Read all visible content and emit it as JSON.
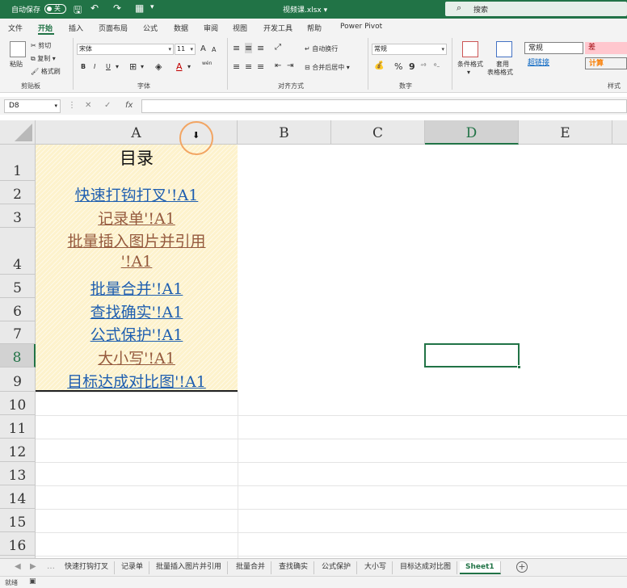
{
  "titlebar": {
    "autosave_label": "自动保存",
    "autosave_state": "关",
    "filename": "视频课.xlsx",
    "search_placeholder": "搜索"
  },
  "ribbon_tabs": [
    "文件",
    "开始",
    "插入",
    "页面布局",
    "公式",
    "数据",
    "审阅",
    "视图",
    "开发工具",
    "帮助",
    "Power Pivot"
  ],
  "ribbon": {
    "clipboard": {
      "paste": "粘贴",
      "cut": "剪切",
      "copy": "复制",
      "format_painter": "格式刷",
      "group": "剪贴板"
    },
    "font": {
      "name": "宋体",
      "size": "11",
      "bold": "B",
      "italic": "I",
      "underline": "U",
      "grow": "A",
      "shrink": "A",
      "color_glyph": "A",
      "phonetic": "wén",
      "group": "字体"
    },
    "alignment": {
      "wrap_text": "自动换行",
      "merge_center": "合并后居中",
      "group": "对齐方式"
    },
    "number": {
      "format": "常规",
      "percent": "%",
      "comma": "9",
      "group": "数字"
    },
    "styles": {
      "conditional": "条件格式",
      "table_format_1": "套用",
      "table_format_2": "表格格式",
      "normal": "常规",
      "bad": "差",
      "hyperlink": "超链接",
      "calc": "计算",
      "group": "样式"
    }
  },
  "formula_bar": {
    "name_box": "D8",
    "cancel": "✕",
    "enter": "✓",
    "fx": "fx",
    "value": ""
  },
  "columns": [
    "A",
    "B",
    "C",
    "D",
    "E"
  ],
  "selected_column": "D",
  "rows": [
    "1",
    "2",
    "3",
    "4",
    "5",
    "6",
    "7",
    "8",
    "9",
    "10",
    "11",
    "12",
    "13",
    "14",
    "15",
    "16"
  ],
  "selected_row": "8",
  "cells": {
    "A1": "目录",
    "A2": "快速打钩打叉'!A1",
    "A3": "记录单'!A1",
    "A4_line1": "批量插入图片并引用",
    "A4_line2": "'!A1",
    "A5": "批量合并'!A1",
    "A6": "查找确实'!A1",
    "A7": "公式保护'!A1",
    "A8": "大小写'!A1",
    "A9": "目标达成对比图'!A1"
  },
  "colors": {
    "excel_green": "#217346",
    "link": "#1f5fb0",
    "visited_link": "#955a3e",
    "cell_fill": "#fdf2cc",
    "cursor_highlight": "#f2a563"
  },
  "sheet_tabs": [
    "快速打钩打叉",
    "记录单",
    "批量插入图片并引用",
    "批量合并",
    "查找确实",
    "公式保护",
    "大小写",
    "目标达成对比图",
    "Sheet1"
  ],
  "active_sheet": "Sheet1",
  "status": {
    "ready": "就绪"
  }
}
